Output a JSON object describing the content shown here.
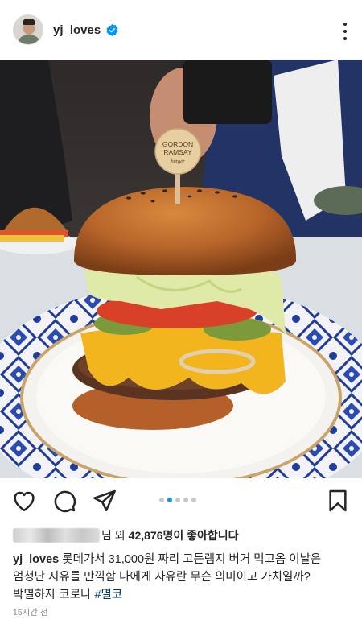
{
  "header": {
    "username": "yj_loves"
  },
  "photo": {
    "pick_line1": "GORDON",
    "pick_line2": "RAMSAY",
    "pick_line3": "burger"
  },
  "carousel": {
    "count": 5,
    "active_index": 1
  },
  "likes": {
    "suffix": "님",
    "prefix": "외",
    "count": "42,876명이 좋아합니다"
  },
  "caption": {
    "username": "yj_loves",
    "line1": "롯데가서 31,000원 짜리 고든램지 버거 먹고옴 이날은",
    "line2": "엄청난 지유를 만끽함 나에게 자유란 무슨 의미이고 가치일까?",
    "line3": "박멸하자 코로나",
    "hashtag": "#멸코"
  },
  "timestamp": "15시간 전",
  "colors": {
    "accent": "#0095f6",
    "text": "#262626",
    "hashtag": "#00376b",
    "muted": "#8e8e8e"
  }
}
